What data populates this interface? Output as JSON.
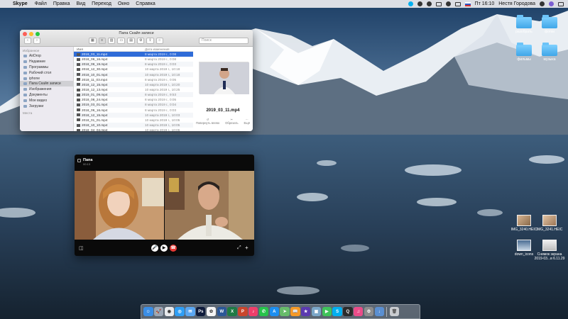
{
  "menubar": {
    "app": "Skype",
    "items": [
      "Файл",
      "Правка",
      "Вид",
      "Переход",
      "Окно",
      "Справка"
    ],
    "time": "Пт 16:10",
    "user": "Нестя Городова"
  },
  "desktop": {
    "items": [
      {
        "label": "разобрать",
        "kind": "folder",
        "icon": "folder-icon"
      },
      {
        "label": "фотки",
        "kind": "folder",
        "icon": "folder-icon"
      },
      {
        "label": "фильмы",
        "kind": "folder",
        "icon": "folder-icon"
      },
      {
        "label": "музыка",
        "kind": "folder",
        "icon": "folder-icon"
      },
      {
        "label": "IMG_3240.HEIC",
        "kind": "image",
        "icon": "image-icon"
      },
      {
        "label": "IMG_3241.HEIC",
        "kind": "image",
        "icon": "image-icon"
      },
      {
        "label": "down_icons",
        "kind": "image",
        "icon": "image-icon"
      },
      {
        "label": "Снимок экрана 2019-03...в 6.11.29",
        "kind": "image",
        "icon": "screenshot-icon"
      }
    ]
  },
  "finder": {
    "title": "Папа Скайп записи",
    "search_placeholder": "Поиск",
    "sidebar": {
      "favorites_header": "Избранное",
      "favorites": [
        "AirDrop",
        "Недавние",
        "Программы",
        "Рабочий стол",
        "iphone",
        "Папа Скайп записи",
        "Изображения",
        "Документы",
        "Мое видео",
        "Загрузки"
      ],
      "selected": "Папа Скайп записи",
      "places_header": "Места"
    },
    "columns": {
      "name": "Имя",
      "date": "Дата изменения"
    },
    "files": [
      {
        "name": "2019_03_11.mp4",
        "date": "8 марта 2019 г., 0:08",
        "selected": true
      },
      {
        "name": "2018_09_16.mp4",
        "date": "8 марта 2019 г., 0:08"
      },
      {
        "name": "2018_09_19.mp4",
        "date": "8 марта 2019 г., 0:03"
      },
      {
        "name": "2018_12_30.mp4",
        "date": "10 марта 2019 г., 10:18"
      },
      {
        "name": "2018_10_01.mp4",
        "date": "10 марта 2019 г., 10:18"
      },
      {
        "name": "2018_11_03.mp4",
        "date": "8 марта 2019 г., 0:05"
      },
      {
        "name": "2018_12_15.mp4",
        "date": "10 марта 2019 г., 10:20"
      },
      {
        "name": "2018_12_13.mp4",
        "date": "10 марта 2019 г., 10:25"
      },
      {
        "name": "2019_01_09.mp4",
        "date": "8 марта 2019 г., 9:53"
      },
      {
        "name": "2018_08_24.mp4",
        "date": "8 марта 2019 г., 0:05"
      },
      {
        "name": "2019_03_01.mp4",
        "date": "8 марта 2019 г., 0:04"
      },
      {
        "name": "2018_09_16.mp4",
        "date": "8 марта 2019 г., 0:03"
      },
      {
        "name": "2018_12_15.mp4",
        "date": "10 марта 2019 г., 10:03"
      },
      {
        "name": "2018_01_01.mp4",
        "date": "10 марта 2019 г., 10:05"
      },
      {
        "name": "2018_10_10.mp4",
        "date": "10 марта 2019 г., 10:05"
      },
      {
        "name": "2018_04_04.mp4",
        "date": "10 марта 2019 г., 10:05"
      }
    ],
    "preview": {
      "filename": "2019_03_11.mp4",
      "actions": [
        "Повернуть влево",
        "Обрезать",
        "Ещё"
      ]
    }
  },
  "skype": {
    "contact_name": "Папа",
    "call_status": "00:13"
  },
  "dock": {
    "apps": [
      {
        "name": "finder-icon",
        "color": "#3a8ee6",
        "glyph": "☺"
      },
      {
        "name": "launchpad-icon",
        "color": "#9aa6b5",
        "glyph": "🚀"
      },
      {
        "name": "chrome-icon",
        "color": "#e8eaed",
        "glyph": "◉"
      },
      {
        "name": "safari-icon",
        "color": "#2e9ef5",
        "glyph": "◎"
      },
      {
        "name": "mail-icon",
        "color": "#5aa7f2",
        "glyph": "✉"
      },
      {
        "name": "photoshop-icon",
        "color": "#0e1b3b",
        "glyph": "Ps"
      },
      {
        "name": "photos-icon",
        "color": "#f4f4f4",
        "glyph": "✿"
      },
      {
        "name": "word-icon",
        "color": "#2b5797",
        "glyph": "W"
      },
      {
        "name": "excel-icon",
        "color": "#1f7a45",
        "glyph": "X"
      },
      {
        "name": "powerpoint-icon",
        "color": "#c9462d",
        "glyph": "P"
      },
      {
        "name": "music-icon",
        "color": "#ee3f6b",
        "glyph": "♪"
      },
      {
        "name": "whatsapp-icon",
        "color": "#27c34b",
        "glyph": "✆"
      },
      {
        "name": "appstore-icon",
        "color": "#1b8ef0",
        "glyph": "A"
      },
      {
        "name": "maps-icon",
        "color": "#67bb6a",
        "glyph": "➤"
      },
      {
        "name": "ibooks-icon",
        "color": "#f59a27",
        "glyph": "📖"
      },
      {
        "name": "imovie-icon",
        "color": "#5b3ab0",
        "glyph": "★"
      },
      {
        "name": "preview-icon",
        "color": "#7aa6c8",
        "glyph": "▣"
      },
      {
        "name": "facetime-icon",
        "color": "#3fc35a",
        "glyph": "▶"
      },
      {
        "name": "skype-icon",
        "color": "#00aff0",
        "glyph": "S"
      },
      {
        "name": "quicktime-icon",
        "color": "#2b2b2b",
        "glyph": "Q"
      },
      {
        "name": "itunes-icon",
        "color": "#ea4c89",
        "glyph": "♫"
      },
      {
        "name": "system-preferences-icon",
        "color": "#8d8d8d",
        "glyph": "⚙"
      },
      {
        "name": "downloads-icon",
        "color": "#5a8fd1",
        "glyph": "↓"
      }
    ],
    "trash": {
      "name": "trash-icon",
      "color": "#c9ccd0",
      "glyph": "🗑"
    }
  }
}
